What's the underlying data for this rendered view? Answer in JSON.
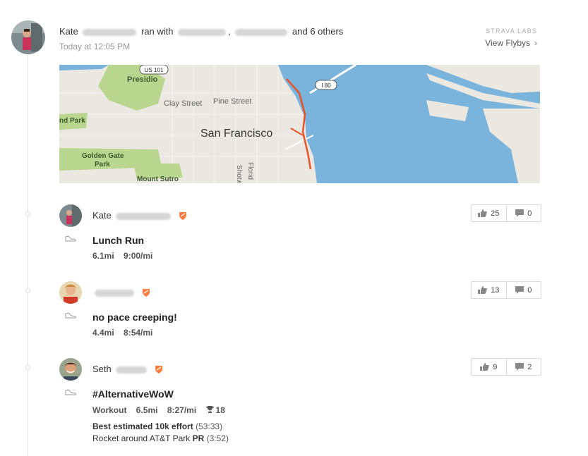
{
  "group": {
    "owner": "Kate",
    "action": "ran with",
    "others": "and 6 others",
    "time": "Today at 12:05 PM"
  },
  "labs": {
    "brand": "STRAVA LABS",
    "link": "View Flybys"
  },
  "map": {
    "labels": {
      "us101": "US 101",
      "presidio": "Presidio",
      "clay": "Clay Street",
      "pine": "Pine Street",
      "i80": "I 80",
      "city": "San Francisco",
      "park_left": "nd Park",
      "golden_gate": "Golden Gate",
      "park": "Park",
      "sutro": "Mount Sutro",
      "shotwell": "Shotw",
      "florida": "Florid"
    },
    "colors": {
      "water": "#7ab3dc",
      "land": "#ebe8e2",
      "park": "#b9d68f",
      "route": "#e8542a"
    }
  },
  "activities": [
    {
      "athlete": "Kate",
      "title": "Lunch Run",
      "distance": "6.1mi",
      "pace": "9:00/mi",
      "kudos": "25",
      "comments": "0"
    },
    {
      "athlete": "",
      "title": "no pace creeping!",
      "distance": "4.4mi",
      "pace": "8:54/mi",
      "kudos": "13",
      "comments": "0"
    },
    {
      "athlete": "Seth",
      "title": "#AlternativeWoW",
      "type": "Workout",
      "distance": "6.5mi",
      "pace": "8:27/mi",
      "trophies": "18",
      "achievement1_bold": "Best estimated 10k effort",
      "achievement1_time": "(53:33)",
      "achievement2_pre": "Rocket around AT&T Park",
      "achievement2_bold": "PR",
      "achievement2_time": "(3:52)",
      "kudos": "9",
      "comments": "2"
    }
  ],
  "icons": [
    "thumbs-up-icon",
    "comment-icon",
    "shoe-icon",
    "shield-badge-icon",
    "trophy-icon",
    "chevron-right-icon"
  ]
}
